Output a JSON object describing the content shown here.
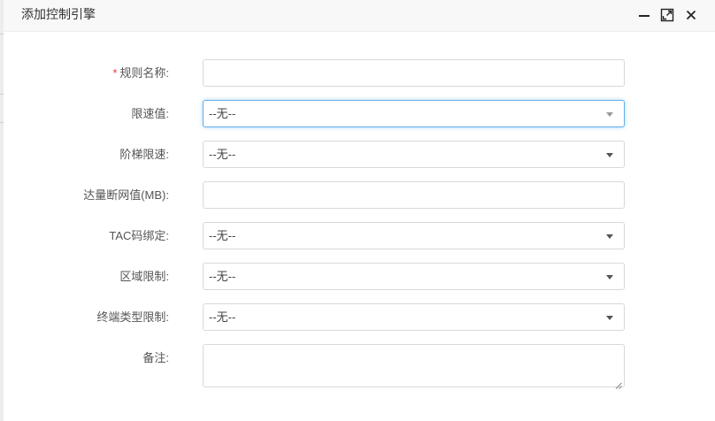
{
  "dialog": {
    "title": "添加控制引擎",
    "icons": {
      "minimize": "minimize-icon",
      "maximize": "maximize-icon",
      "close": "close-icon"
    }
  },
  "form": {
    "rule_name": {
      "required_mark": "*",
      "label": "规则名称:",
      "value": ""
    },
    "speed_limit": {
      "label": "限速值:",
      "value": "--无--"
    },
    "tiered_limit": {
      "label": "阶梯限速:",
      "value": "--无--"
    },
    "cutoff_traffic": {
      "label": "达量断网值(MB):",
      "value": ""
    },
    "tac_binding": {
      "label": "TAC码绑定:",
      "value": "--无--"
    },
    "area_limit": {
      "label": "区域限制:",
      "value": "--无--"
    },
    "terminal_type_limit": {
      "label": "终端类型限制:",
      "value": "--无--"
    },
    "remarks": {
      "label": "备注:",
      "value": ""
    }
  },
  "colors": {
    "required": "#e53e30",
    "focus_border": "#66afe9",
    "border": "#d9d9d9"
  }
}
